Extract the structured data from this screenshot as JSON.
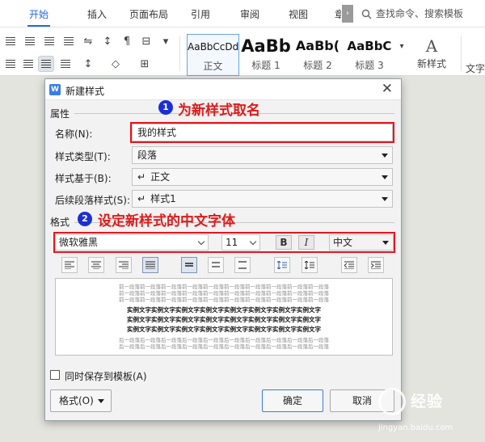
{
  "ribbon": {
    "tabs": [
      {
        "label": "开始",
        "active": true
      },
      {
        "label": "插入",
        "active": false
      },
      {
        "label": "页面布局",
        "active": false
      },
      {
        "label": "引用",
        "active": false
      },
      {
        "label": "审阅",
        "active": false
      },
      {
        "label": "视图",
        "active": false
      },
      {
        "label": "章",
        "active": false
      }
    ],
    "search_label": "查找命令、搜索模板",
    "styles": [
      {
        "preview": "AaBbCcDd",
        "name": "正文"
      },
      {
        "preview": "AaBb",
        "name": "标题 1"
      },
      {
        "preview": "AaBb(",
        "name": "标题 2"
      },
      {
        "preview": "AaBbC",
        "name": "标题 3"
      }
    ],
    "new_style_label": "新样式",
    "cut_off_label": "文字",
    "accent_color": "#2468e6"
  },
  "dialog": {
    "title": "新建样式",
    "close_glyph": "✕",
    "section_properties": "属性",
    "section_format": "格式",
    "rows": {
      "name": {
        "label": "名称(N):",
        "value": "我的样式"
      },
      "type": {
        "label": "样式类型(T):",
        "value": "段落"
      },
      "based_on": {
        "label": "样式基于(B):",
        "value": "正文"
      },
      "next_style": {
        "label": "后续段落样式(S):",
        "value": "样式1"
      }
    },
    "font": {
      "family": "微软雅黑",
      "size": "11",
      "bold": "B",
      "italic": "I",
      "script": "中文"
    },
    "preview": {
      "prev_paragraph": "前一段落前一段落前一段落前一段落前一段落前一段落前一段落前一段落前一段落前一段落",
      "sample_text": "实例文字实例文字实例文字实例文字实例文字实例文字实例文字实例文字",
      "next_paragraph": "后一段落后一段落后一段落后一段落后一段落后一段落后一段落后一段落后一段落后一段落"
    },
    "save_to_template": "同时保存到模板(A)",
    "format_button": "格式(O)",
    "ok_button": "确定",
    "cancel_button": "取消"
  },
  "annotations": [
    {
      "number": "1",
      "text": "为新样式取名"
    },
    {
      "number": "2",
      "text": "设定新样式的中文字体"
    }
  ],
  "annotation_colors": {
    "circle": "#1c2fd4",
    "text": "#e01919"
  },
  "watermark": {
    "brand": "经验",
    "url": "jingyan.baidu.com"
  }
}
